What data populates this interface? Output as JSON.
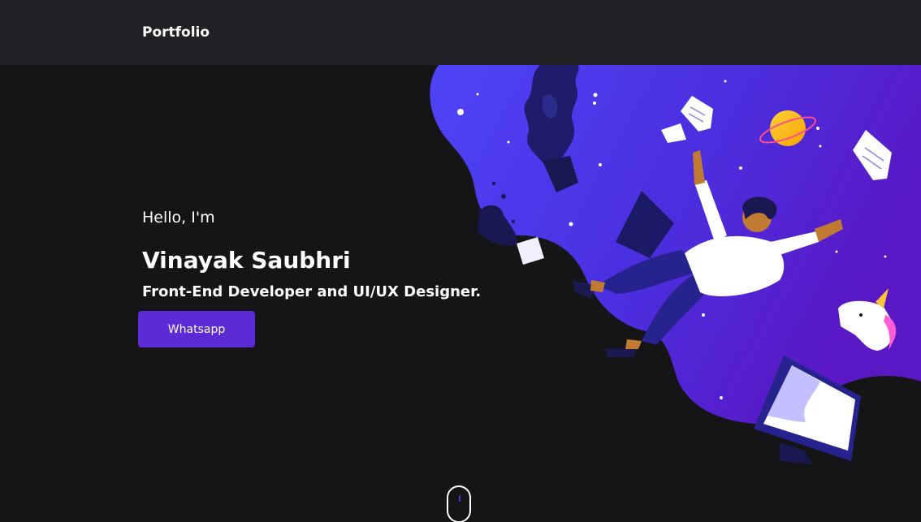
{
  "header": {
    "brand": "Portfolio"
  },
  "hero": {
    "greeting": "Hello, I'm",
    "name": "Vinayak Saubhri",
    "role": "Front-End Developer and UI/UX Designer.",
    "cta_label": "Whatsapp"
  },
  "colors": {
    "background": "#151417",
    "header_background": "#212024",
    "accent": "#5b2bd6",
    "illustration_blob_start": "#4e3cf5",
    "illustration_blob_end": "#5a17c4"
  },
  "icons": {
    "scroll": "mouse-scroll-icon"
  }
}
